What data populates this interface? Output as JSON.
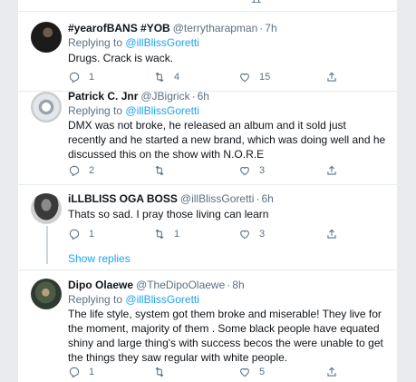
{
  "top_partial": {
    "like_count": "11"
  },
  "tweets": [
    {
      "name": "#yearofBANS #YOB",
      "handle": "@terrytharapman",
      "time": "7h",
      "replying_prefix": "Replying to",
      "replying_to": "@illBlissGoretti",
      "text": "Drugs. Crack is wack.",
      "replies": "1",
      "retweets": "4",
      "likes": "15",
      "avatar_color": "#1b1b1b"
    },
    {
      "name": "Patrick C. Jnr",
      "handle": "@JBigrick",
      "time": "6h",
      "replying_prefix": "Replying to",
      "replying_to": "@illBlissGoretti",
      "text": "DMX was not broke, he released an album and it sold just recently and he started a new brand, which was doing well and he discussed this on the show with N.O.R.E",
      "replies": "2",
      "retweets": "",
      "likes": "3",
      "avatar_color": "#c9ccd0"
    },
    {
      "name": "iLLBLISS OGA BOSS",
      "handle": "@illBlissGoretti",
      "time": "6h",
      "text": "Thats so sad. I pray those living can learn",
      "replies": "1",
      "retweets": "1",
      "likes": "3",
      "avatar_color": "#3a3a3a"
    },
    {
      "name": "Dipo Olaewe",
      "handle": "@TheDipoOlaewe",
      "time": "8h",
      "replying_prefix": "Replying to",
      "replying_to": "@illBlissGoretti",
      "text": "The life style, system  got them broke and miserable!  They live for the moment, majority of them . Some black people have equated shiny and large thing's with success becos the were unable to get the things they saw regular with white people.",
      "replies": "1",
      "retweets": "",
      "likes": "5",
      "avatar_color": "#2f3a30"
    }
  ],
  "show_replies_label": "Show replies"
}
